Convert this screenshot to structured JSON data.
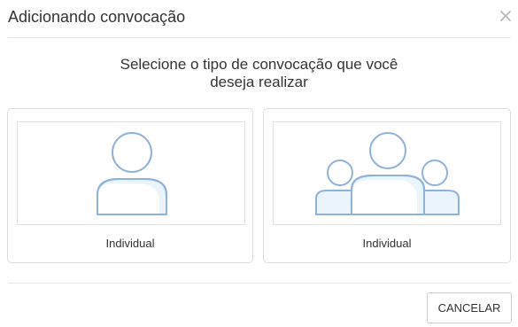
{
  "dialog": {
    "title": "Adicionando convocação",
    "close_icon": "close-icon"
  },
  "prompt": {
    "line1": "Selecione o tipo de convocação que você",
    "line2": "deseja realizar"
  },
  "options": [
    {
      "label": "Individual",
      "icon": "single-person-icon"
    },
    {
      "label": "Individual",
      "icon": "group-people-icon"
    }
  ],
  "footer": {
    "cancel_label": "CANCELAR"
  },
  "colors": {
    "icon_stroke": "#8fb2d8",
    "icon_fill": "#eaf4fb",
    "border": "#dcdcdc",
    "text": "#333333"
  }
}
